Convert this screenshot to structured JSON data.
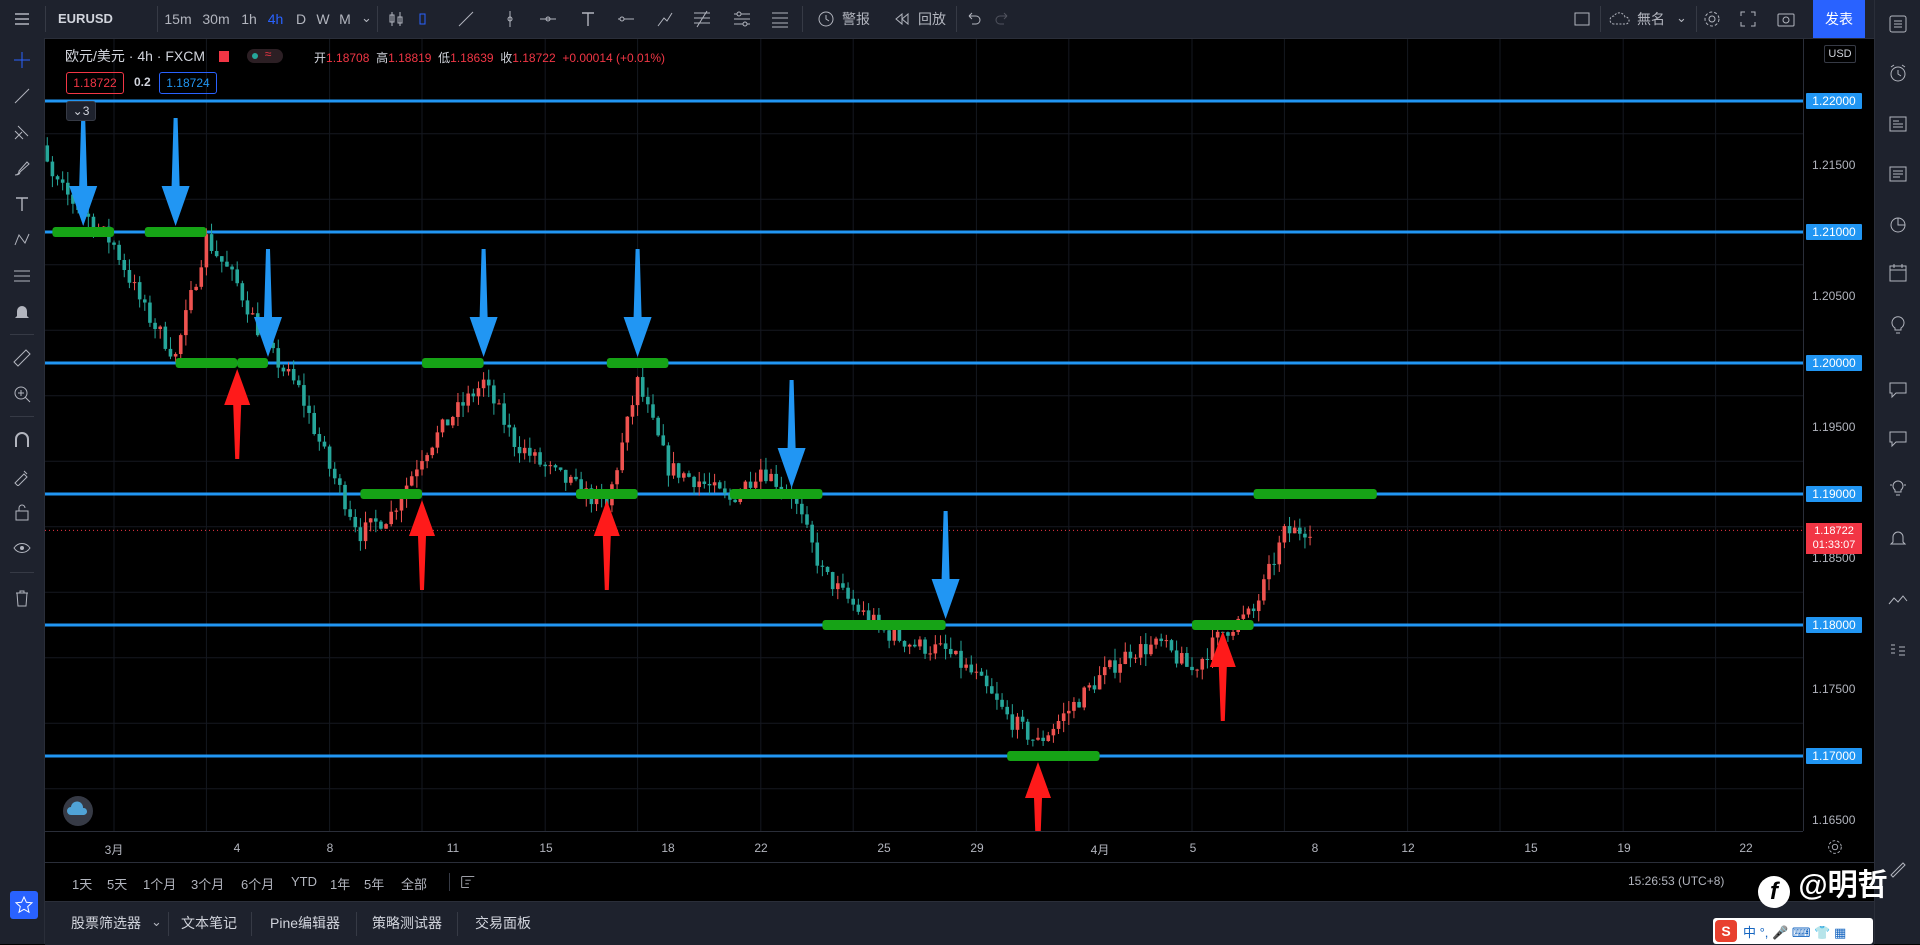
{
  "toolbar": {
    "symbol": "EURUSD",
    "intervals": [
      "15m",
      "30m",
      "1h",
      "4h",
      "D",
      "W",
      "M"
    ],
    "active_interval": "4h",
    "alert_label": "警报",
    "replay_label": "回放",
    "layout_name": "無名",
    "publish_label": "发表"
  },
  "legend": {
    "title": "欧元/美元 · 4h · FXCM",
    "open_key": "开",
    "open": "1.18708",
    "high_key": "高",
    "high": "1.18819",
    "low_key": "低",
    "low": "1.18639",
    "close_key": "收",
    "close": "1.18722",
    "change": "+0.00014 (+0.01%)",
    "sell_price": "1.18722",
    "spread": "0.2",
    "buy_price": "1.18724",
    "indicator_count": "3"
  },
  "price_scale": {
    "currency": "USD",
    "ticks": [
      "1.21500",
      "1.20500",
      "1.19500",
      "1.18500",
      "1.17500",
      "1.16500"
    ],
    "level_labels": [
      "1.22000",
      "1.21000",
      "1.20000",
      "1.19000",
      "1.18000",
      "1.17000"
    ],
    "last_price": "1.18722",
    "countdown": "01:33:07"
  },
  "time_axis": {
    "ticks": [
      "3月",
      "4",
      "8",
      "11",
      "15",
      "18",
      "22",
      "25",
      "29",
      "4月",
      "5",
      "8",
      "12",
      "15",
      "19",
      "22"
    ]
  },
  "ranges": [
    "1天",
    "5天",
    "1个月",
    "3个月",
    "6个月",
    "YTD",
    "1年",
    "5年",
    "全部"
  ],
  "clock": "15:26:53 (UTC+8)",
  "bottom_tabs": [
    "股票筛选器",
    "文本笔记",
    "Pine编辑器",
    "策略测试器",
    "交易面板"
  ],
  "watermark": "@明哲",
  "chart_data": {
    "type": "candlestick",
    "symbol": "EURUSD",
    "interval": "4h",
    "y_range": [
      1.1625,
      1.2225
    ],
    "x_range": [
      "2021-02-26",
      "2021-04-24"
    ],
    "horizontal_levels": [
      1.22,
      1.21,
      1.2,
      1.19,
      1.18,
      1.17
    ],
    "path": [
      [
        "2021-02-26",
        1.2205
      ],
      [
        "2021-02-27",
        1.214
      ],
      [
        "2021-03-01",
        1.209
      ],
      [
        "2021-03-02",
        1.204
      ],
      [
        "2021-03-03",
        1.2005
      ],
      [
        "2021-03-04",
        1.2095
      ],
      [
        "2021-03-05",
        1.206
      ],
      [
        "2021-03-06",
        1.201
      ],
      [
        "2021-03-07",
        1.198
      ],
      [
        "2021-03-08",
        1.192
      ],
      [
        "2021-03-09",
        1.187
      ],
      [
        "2021-03-10",
        1.1885
      ],
      [
        "2021-03-11",
        1.193
      ],
      [
        "2021-03-12",
        1.196
      ],
      [
        "2021-03-13",
        1.1985
      ],
      [
        "2021-03-14",
        1.194
      ],
      [
        "2021-03-15",
        1.192
      ],
      [
        "2021-03-16",
        1.1905
      ],
      [
        "2021-03-17",
        1.189
      ],
      [
        "2021-03-18",
        1.1985
      ],
      [
        "2021-03-19",
        1.192
      ],
      [
        "2021-03-20",
        1.191
      ],
      [
        "2021-03-21",
        1.1895
      ],
      [
        "2021-03-22",
        1.192
      ],
      [
        "2021-03-23",
        1.19
      ],
      [
        "2021-03-24",
        1.184
      ],
      [
        "2021-03-25",
        1.1815
      ],
      [
        "2021-03-26",
        1.1795
      ],
      [
        "2021-03-27",
        1.1785
      ],
      [
        "2021-03-28",
        1.178
      ],
      [
        "2021-03-29",
        1.176
      ],
      [
        "2021-03-30",
        1.173
      ],
      [
        "2021-03-31",
        1.171
      ],
      [
        "2021-04-01",
        1.1735
      ],
      [
        "2021-04-02",
        1.176
      ],
      [
        "2021-04-03",
        1.178
      ],
      [
        "2021-04-04",
        1.1785
      ],
      [
        "2021-04-05",
        1.1765
      ],
      [
        "2021-04-06",
        1.1795
      ],
      [
        "2021-04-07",
        1.181
      ],
      [
        "2021-04-08",
        1.187
      ],
      [
        "2021-04-09",
        1.1875
      ]
    ],
    "blue_arrows_down": [
      [
        "2021-02-28",
        1.21
      ],
      [
        "2021-03-03",
        1.21
      ],
      [
        "2021-03-06",
        1.2
      ],
      [
        "2021-03-13",
        1.2
      ],
      [
        "2021-03-18",
        1.2
      ],
      [
        "2021-03-23",
        1.19
      ],
      [
        "2021-03-28",
        1.18
      ]
    ],
    "red_arrows_up": [
      [
        "2021-03-05",
        1.2
      ],
      [
        "2021-03-11",
        1.19
      ],
      [
        "2021-03-17",
        1.19
      ],
      [
        "2021-03-31",
        1.17
      ],
      [
        "2021-04-06",
        1.18
      ]
    ],
    "green_zones": [
      [
        "2021-02-27",
        "2021-03-01",
        1.21
      ],
      [
        "2021-03-02",
        "2021-03-04",
        1.21
      ],
      [
        "2021-03-03",
        "2021-03-05",
        1.2
      ],
      [
        "2021-03-05",
        "2021-03-06",
        1.2
      ],
      [
        "2021-03-11",
        "2021-03-13",
        1.2
      ],
      [
        "2021-03-17",
        "2021-03-19",
        1.2
      ],
      [
        "2021-03-09",
        "2021-03-11",
        1.19
      ],
      [
        "2021-03-16",
        "2021-03-18",
        1.19
      ],
      [
        "2021-03-21",
        "2021-03-24",
        1.19
      ],
      [
        "2021-04-07",
        "2021-04-11",
        1.19
      ],
      [
        "2021-03-24",
        "2021-03-28",
        1.18
      ],
      [
        "2021-04-05",
        "2021-04-07",
        1.18
      ],
      [
        "2021-03-30",
        "2021-04-02",
        1.17
      ]
    ],
    "colors": {
      "up": "#ef5350",
      "down": "#26a69a",
      "level": "#2196f3",
      "zone": "#16a316",
      "blue_arrow": "#2196f3",
      "red_arrow": "#ff1a1a"
    }
  }
}
